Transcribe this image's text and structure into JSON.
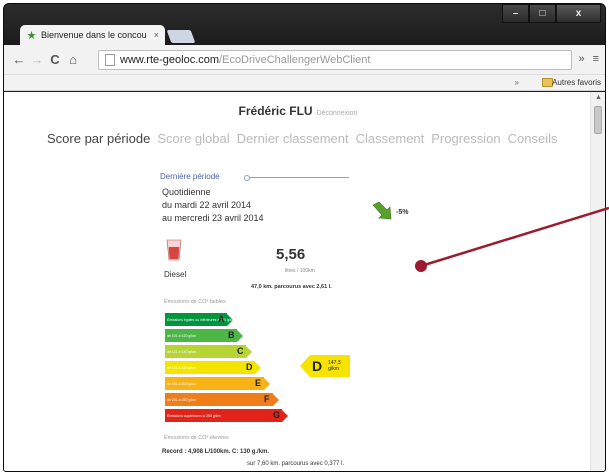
{
  "browser": {
    "tab_title": "Bienvenue dans le concou",
    "tab_close": "×",
    "url_host": "www.rte-geoloc.com",
    "url_path": "/EcoDriveChallengerWebClient",
    "window_minimize": "–",
    "window_maximize": "□",
    "window_close": "x",
    "back": "←",
    "forward": "→",
    "reload": "C",
    "home": "⌂",
    "overflow": "»",
    "menu": "≡",
    "bookmarks_overflow": "»",
    "bookmark_folder_label": "Autres favoris"
  },
  "header": {
    "user_name": "Frédéric FLU",
    "logout": "Déconnexion"
  },
  "nav": {
    "items": [
      {
        "label": "Score par période"
      },
      {
        "label": "Score global"
      },
      {
        "label": "Dernier classement"
      },
      {
        "label": "Classement"
      },
      {
        "label": "Progression"
      },
      {
        "label": "Conseils"
      }
    ]
  },
  "period": {
    "title": "Dernière période",
    "frequency": "Quotidienne",
    "from": "du mardi 22 avril 2014",
    "to": "au mercredi 23 avril 2014",
    "trend": "-5%"
  },
  "consumption": {
    "fuel": "Diesel",
    "value": "5,56",
    "unit": "litres / 100km",
    "summary": "47,0 km. parcourus avec 2,61 l."
  },
  "emissions": {
    "low_label": "Émissions de CO² faibles",
    "high_label": "Émissions de CO² élevées",
    "bands": [
      {
        "letter": "A",
        "text": "Émissions égales ou inférieures à 100 g/km",
        "color": "#00963f",
        "width": 0.48
      },
      {
        "letter": "B",
        "text": "de 101 à 120 g/km",
        "color": "#4cb747",
        "width": 0.55
      },
      {
        "letter": "C",
        "text": "de 121 à 140 g/km",
        "color": "#b6d433",
        "width": 0.62
      },
      {
        "letter": "D",
        "text": "de 141 à 160 g/km",
        "color": "#f4e500",
        "width": 0.69
      },
      {
        "letter": "E",
        "text": "de 161 à 200 g/km",
        "color": "#f8b216",
        "width": 0.76
      },
      {
        "letter": "F",
        "text": "de 201 à 250 g/km",
        "color": "#ef7d1a",
        "width": 0.83
      },
      {
        "letter": "G",
        "text": "Émissions supérieures à 250 g/km",
        "color": "#e2231a",
        "width": 0.9
      }
    ],
    "rating_letter": "D",
    "rating_value": "147,3",
    "rating_unit": "g/km"
  },
  "record": {
    "line1": "Record : 4,908 L/100km. C: 130 g./km.",
    "line2": "sur 7,60 km. parcourus avec 0,377 l."
  },
  "colors": {
    "annotation": "#9b1b30",
    "accent_link": "#4863a6"
  }
}
